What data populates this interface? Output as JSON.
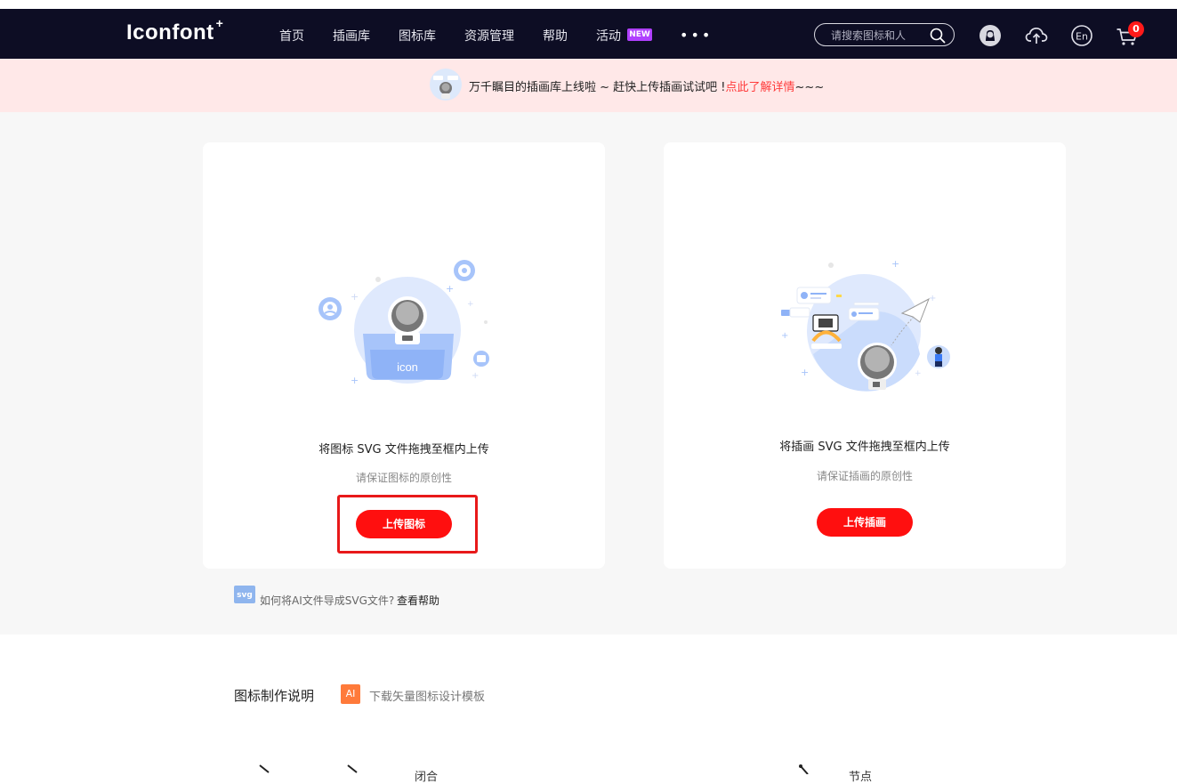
{
  "navbar": {
    "logo": "Iconfont",
    "logo_plus": "+",
    "items": [
      {
        "label": "首页"
      },
      {
        "label": "插画库"
      },
      {
        "label": "图标库"
      },
      {
        "label": "资源管理"
      },
      {
        "label": "帮助"
      },
      {
        "label": "活动"
      }
    ],
    "new_badge": "NEW",
    "more": "•••",
    "search_placeholder": "请搜索图标和人",
    "cart_count": "0",
    "icons": [
      "github-icon",
      "upload-cloud-icon",
      "language-en-icon",
      "cart-icon"
    ]
  },
  "banner": {
    "text": "万千瞩目的插画库上线啦 ~ 赶快上传插画试试吧 !",
    "link": "点此了解详情",
    "tail": "~~~"
  },
  "cards": [
    {
      "illustration_label": "icon",
      "title": "将图标 SVG 文件拖拽至框内上传",
      "subtitle": "请保证图标的原创性",
      "button": "上传图标"
    },
    {
      "title": "将插画 SVG 文件拖拽至框内上传",
      "subtitle": "请保证插画的原创性",
      "button": "上传插画"
    }
  ],
  "help": {
    "badge": "svg",
    "text": "如何将AI文件导成SVG文件?",
    "link": "查看帮助"
  },
  "doc": {
    "title": "图标制作说明",
    "ai_badge": "AI",
    "ai_link": "下载矢量图标设计模板"
  },
  "bottom_labels": [
    "闭合",
    "节点"
  ],
  "colors": {
    "navbar_bg": "#0d0d24",
    "accent_red": "#ff0f0f",
    "banner_bg": "#ffe8e8",
    "illustration_blue": "#a7c4fa"
  }
}
